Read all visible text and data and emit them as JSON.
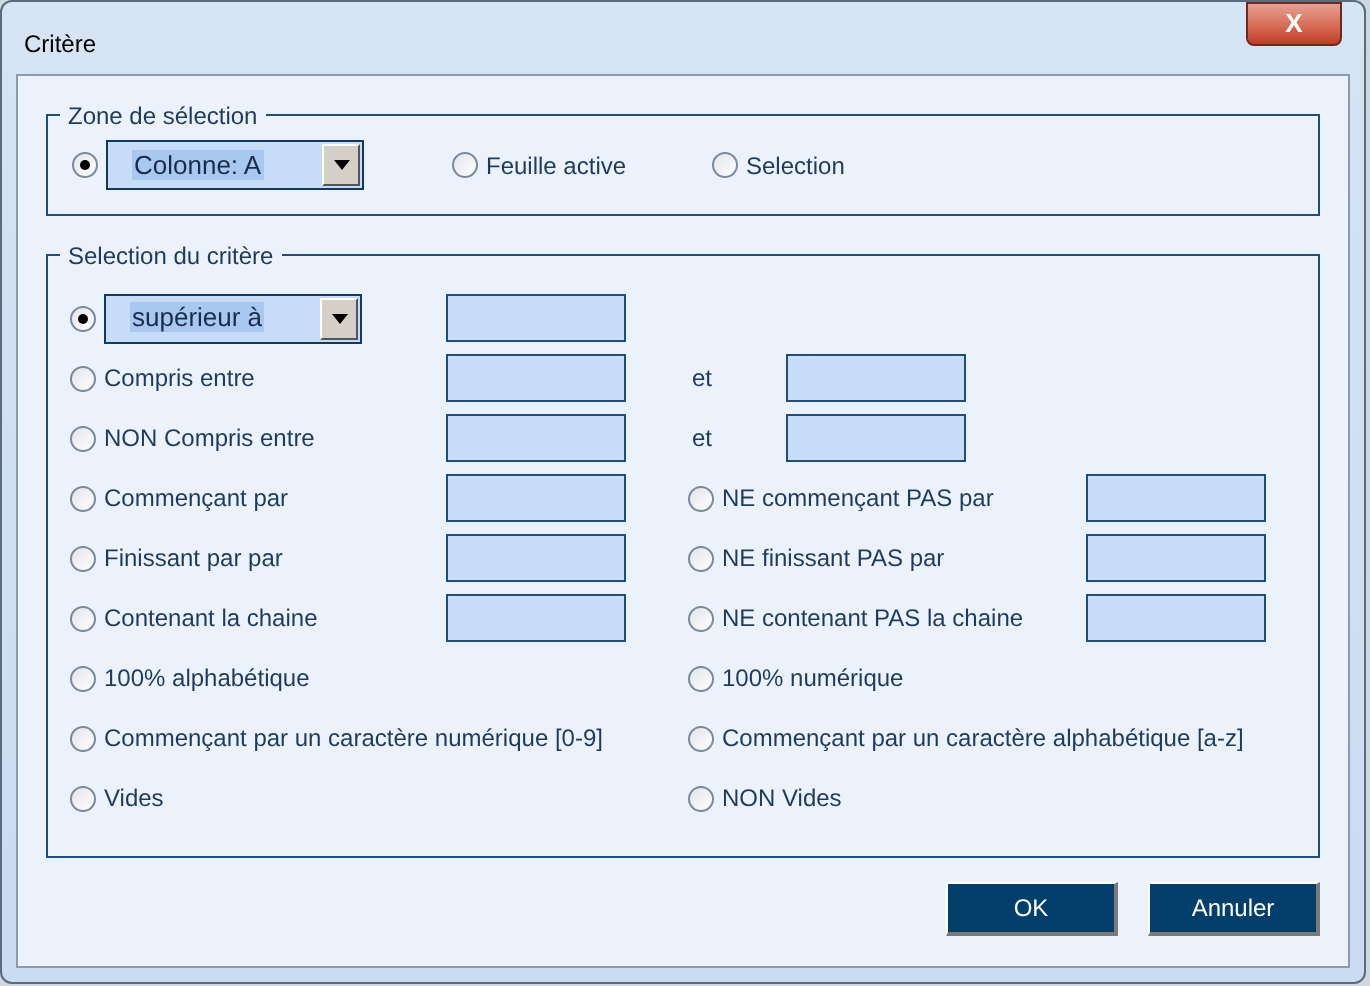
{
  "window": {
    "title": "Critère",
    "close_label": "X"
  },
  "zone": {
    "title": "Zone de sélection",
    "options": [
      {
        "kind": "dropdown",
        "value": "Colonne: A",
        "selected": true
      },
      {
        "kind": "radio",
        "label": "Feuille active",
        "selected": false
      },
      {
        "kind": "radio",
        "label": "Selection",
        "selected": false
      }
    ]
  },
  "criteria": {
    "title": "Selection du critère",
    "rows": [
      {
        "left": {
          "kind": "dropdown",
          "value": "supérieur à",
          "selected": true,
          "has_field": true
        }
      },
      {
        "left": {
          "kind": "radio",
          "label": "Compris entre",
          "selected": false,
          "has_field": true
        },
        "and": "et"
      },
      {
        "left": {
          "kind": "radio",
          "label": "NON Compris entre",
          "selected": false,
          "has_field": true
        },
        "and": "et"
      },
      {
        "left": {
          "kind": "radio",
          "label": "Commençant par",
          "selected": false,
          "has_field": true
        },
        "right": {
          "label": "NE commençant PAS par",
          "selected": false,
          "has_field": true
        }
      },
      {
        "left": {
          "kind": "radio",
          "label": "Finissant par par",
          "selected": false,
          "has_field": true
        },
        "right": {
          "label": "NE finissant PAS par",
          "selected": false,
          "has_field": true
        }
      },
      {
        "left": {
          "kind": "radio",
          "label": "Contenant la chaine",
          "selected": false,
          "has_field": true
        },
        "right": {
          "label": "NE contenant PAS la chaine",
          "selected": false,
          "has_field": true
        }
      },
      {
        "left": {
          "kind": "radio",
          "label": "100% alphabétique",
          "selected": false,
          "has_field": false
        },
        "right": {
          "label": "100% numérique",
          "selected": false,
          "has_field": false
        }
      },
      {
        "left": {
          "kind": "radio",
          "label": "Commençant par un caractère numérique [0-9]",
          "selected": false,
          "has_field": false
        },
        "right": {
          "label": "Commençant par un caractère alphabétique [a-z]",
          "selected": false,
          "has_field": false
        }
      },
      {
        "left": {
          "kind": "radio",
          "label": "Vides",
          "selected": false,
          "has_field": false
        },
        "right": {
          "label": "NON Vides",
          "selected": false,
          "has_field": false
        }
      }
    ]
  },
  "buttons": [
    "OK",
    "Annuler"
  ]
}
